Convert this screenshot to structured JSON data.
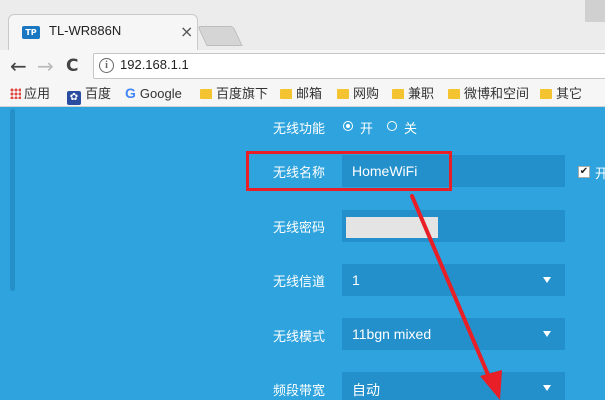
{
  "browser": {
    "tab_icon": "TP",
    "tab_title": "TL-WR886N",
    "tab_close": "×",
    "back": "←",
    "forward": "→",
    "reload": "C",
    "url": "192.168.1.1",
    "info": "i"
  },
  "bookmarks": [
    {
      "label": "应用",
      "icon": "apps-grid-icon"
    },
    {
      "label": "百度",
      "icon": "baidu-paw-icon"
    },
    {
      "label": "Google",
      "icon": "google-icon"
    },
    {
      "label": "百度旗下",
      "icon": "folder-icon"
    },
    {
      "label": "邮箱",
      "icon": "folder-icon"
    },
    {
      "label": "网购",
      "icon": "folder-icon"
    },
    {
      "label": "兼职",
      "icon": "folder-icon"
    },
    {
      "label": "微博和空间",
      "icon": "folder-icon"
    },
    {
      "label": "其它",
      "icon": "folder-icon"
    }
  ],
  "wireless": {
    "function_label": "无线功能",
    "function_on": "开",
    "function_off": "关",
    "function_value": "开",
    "name_label": "无线名称",
    "name_value": "HomeWiFi",
    "hide_label": "开",
    "password_label": "无线密码",
    "channel_label": "无线信道",
    "channel_value": "1",
    "mode_label": "无线模式",
    "mode_value": "11bgn mixed",
    "bandwidth_label": "频段带宽",
    "bandwidth_value": "自动"
  },
  "colors": {
    "page_bg": "#2ea3dd",
    "field_bg": "#2390cc",
    "annotation": "#e81f27"
  }
}
